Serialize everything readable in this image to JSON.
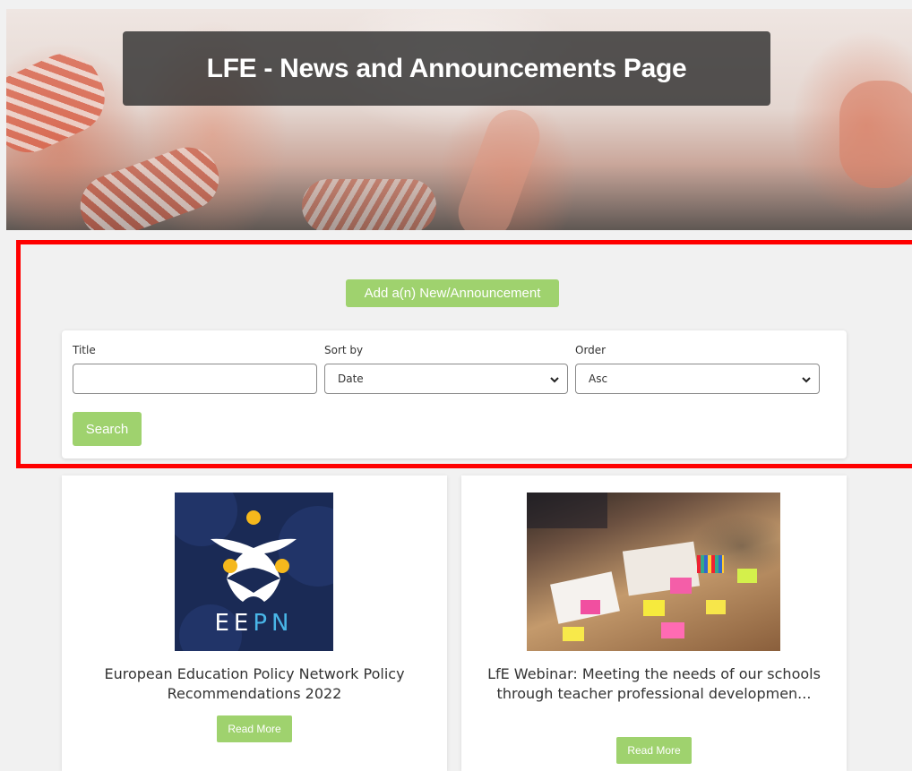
{
  "hero": {
    "title": "LFE - News and Announcements Page"
  },
  "toolbar": {
    "add_label": "Add a(n) New/Announcement"
  },
  "search": {
    "title_label": "Title",
    "title_value": "",
    "sort_label": "Sort by",
    "sort_value": "Date",
    "order_label": "Order",
    "order_value": "Asc",
    "search_label": "Search"
  },
  "cards": [
    {
      "image_text_a": "EE",
      "image_text_b": "PN",
      "title": "European Education Policy Network Policy Recommendations 2022",
      "read_more": "Read More"
    },
    {
      "title": "LfE Webinar: Meeting the needs of our schools through teacher professional developmen...",
      "read_more": "Read More"
    }
  ],
  "colors": {
    "accent": "#9fd26e",
    "highlight": "#ff0000",
    "eepn_bg": "#1a2a55",
    "eepn_dots": "#f5b81c"
  }
}
